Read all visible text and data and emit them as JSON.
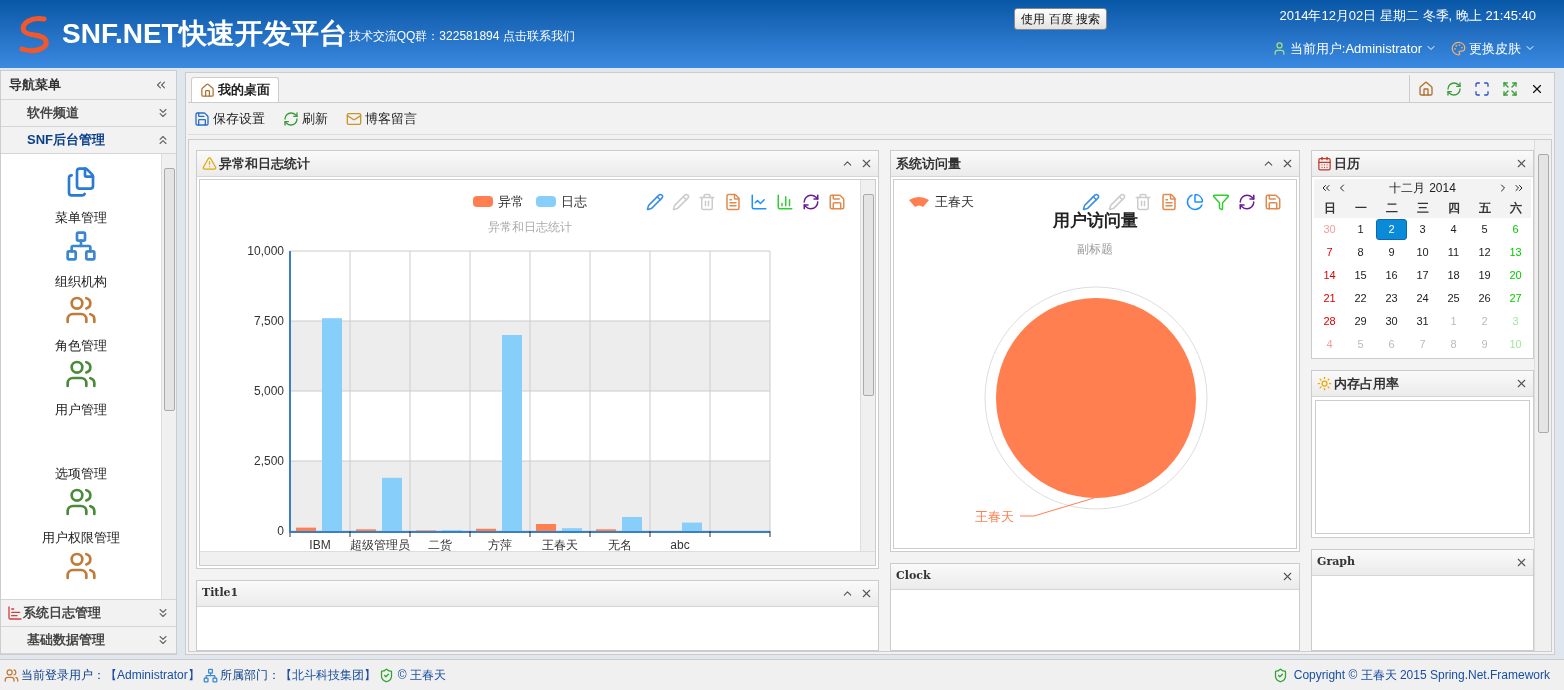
{
  "header": {
    "title": "SNF.NET快速开发平台",
    "qq_info": "技术交流QQ群：322581894 点击联系我们",
    "search_button": "使用 百度 搜索",
    "datetime": "2014年12月02日 星期二 冬季, 晚上 21:45:40",
    "current_user": "当前用户:Administrator",
    "skin_menu": "更换皮肤"
  },
  "sidebar": {
    "title": "导航菜单",
    "groups": [
      {
        "label": "软件频道",
        "kind": "plain",
        "expanded": false
      },
      {
        "label": "SNF后台管理",
        "kind": "plain",
        "expanded": true,
        "items": [
          {
            "label": "菜单管理",
            "kind": "menu"
          },
          {
            "label": "组织机构",
            "kind": "org"
          },
          {
            "label": "角色管理",
            "kind": "role"
          },
          {
            "label": "用户管理",
            "kind": "users"
          },
          {
            "label": "选项管理",
            "kind": "none"
          },
          {
            "label": "用户权限管理",
            "kind": "users"
          },
          {
            "kind": "role"
          }
        ]
      },
      {
        "label": "系统日志管理",
        "kind": "chart",
        "expanded": false
      },
      {
        "label": "基础数据管理",
        "kind": "plain",
        "expanded": false
      }
    ]
  },
  "tabs": [
    {
      "label": "我的桌面",
      "selected": true
    }
  ],
  "toolbar": [
    {
      "label": "保存设置",
      "kind": "save"
    },
    {
      "label": "刷新",
      "kind": "refresh"
    },
    {
      "label": "博客留言",
      "kind": "mail"
    }
  ],
  "portal": {
    "exceptions": {
      "title": "异常和日志统计",
      "collapsible": true,
      "chart_data": {
        "type": "bar",
        "title": "异常和日志统计",
        "categories": [
          "IBM",
          "超级管理员",
          "二货",
          "方萍",
          "王春天",
          "无名",
          "abc"
        ],
        "series": [
          {
            "name": "异常",
            "color": "#ff7f50",
            "values": [
              120,
              60,
              20,
              80,
              250,
              60,
              0
            ]
          },
          {
            "name": "日志",
            "color": "#87cefa",
            "values": [
              7600,
              1900,
              30,
              7000,
              100,
              500,
              300
            ]
          }
        ],
        "grid": true,
        "ylim": [
          0,
          10000
        ],
        "yticks": [
          {
            "value": 0,
            "label": "0"
          },
          {
            "value": 2500,
            "label": "2,500"
          },
          {
            "value": 5000,
            "label": "5,000"
          },
          {
            "value": 7500,
            "label": "7,500"
          },
          {
            "value": 10000,
            "label": "10,000"
          }
        ]
      }
    },
    "visits": {
      "title": "系统访问量",
      "collapsible": true,
      "legend": "王春天",
      "chart_title": "用户访问量",
      "chart_subtitle": "副标题",
      "slice_label": "王春天"
    },
    "calendar": {
      "title": "日历",
      "collapsible": false,
      "month": "十二月",
      "year": "2014",
      "weekdays": [
        "日",
        "一",
        "二",
        "三",
        "四",
        "五",
        "六"
      ],
      "weeks": [
        [
          {
            "day": "30",
            "outside": true,
            "selected": false
          },
          {
            "day": "1",
            "outside": false,
            "selected": false
          },
          {
            "day": "2",
            "outside": false,
            "selected": true
          },
          {
            "day": "3",
            "outside": false,
            "selected": false
          },
          {
            "day": "4",
            "outside": false,
            "selected": false
          },
          {
            "day": "5",
            "outside": false,
            "selected": false
          },
          {
            "day": "6",
            "outside": false,
            "selected": false
          }
        ],
        [
          {
            "day": "7",
            "outside": false,
            "selected": false
          },
          {
            "day": "8",
            "outside": false,
            "selected": false
          },
          {
            "day": "9",
            "outside": false,
            "selected": false
          },
          {
            "day": "10",
            "outside": false,
            "selected": false
          },
          {
            "day": "11",
            "outside": false,
            "selected": false
          },
          {
            "day": "12",
            "outside": false,
            "selected": false
          },
          {
            "day": "13",
            "outside": false,
            "selected": false
          }
        ],
        [
          {
            "day": "14",
            "outside": false,
            "selected": false
          },
          {
            "day": "15",
            "outside": false,
            "selected": false
          },
          {
            "day": "16",
            "outside": false,
            "selected": false
          },
          {
            "day": "17",
            "outside": false,
            "selected": false
          },
          {
            "day": "18",
            "outside": false,
            "selected": false
          },
          {
            "day": "19",
            "outside": false,
            "selected": false
          },
          {
            "day": "20",
            "outside": false,
            "selected": false
          }
        ],
        [
          {
            "day": "21",
            "outside": false,
            "selected": false
          },
          {
            "day": "22",
            "outside": false,
            "selected": false
          },
          {
            "day": "23",
            "outside": false,
            "selected": false
          },
          {
            "day": "24",
            "outside": false,
            "selected": false
          },
          {
            "day": "25",
            "outside": false,
            "selected": false
          },
          {
            "day": "26",
            "outside": false,
            "selected": false
          },
          {
            "day": "27",
            "outside": false,
            "selected": false
          }
        ],
        [
          {
            "day": "28",
            "outside": false,
            "selected": false
          },
          {
            "day": "29",
            "outside": false,
            "selected": false
          },
          {
            "day": "30",
            "outside": false,
            "selected": false
          },
          {
            "day": "31",
            "outside": false,
            "selected": false
          },
          {
            "day": "1",
            "outside": true,
            "selected": false
          },
          {
            "day": "2",
            "outside": true,
            "selected": false
          },
          {
            "day": "3",
            "outside": true,
            "selected": false
          }
        ],
        [
          {
            "day": "4",
            "outside": true,
            "selected": false
          },
          {
            "day": "5",
            "outside": true,
            "selected": false
          },
          {
            "day": "6",
            "outside": true,
            "selected": false
          },
          {
            "day": "7",
            "outside": true,
            "selected": false
          },
          {
            "day": "8",
            "outside": true,
            "selected": false
          },
          {
            "day": "9",
            "outside": true,
            "selected": false
          },
          {
            "day": "10",
            "outside": true,
            "selected": false
          }
        ]
      ]
    },
    "memory": {
      "title": "内存占用率",
      "collapsible": false
    },
    "title1": {
      "title": "Title1",
      "collapsible": true
    },
    "clock": {
      "title": "Clock",
      "collapsible": false
    },
    "graph": {
      "title": "Graph",
      "collapsible": false
    }
  },
  "footer": {
    "login_label": "当前登录用户：",
    "login_user": "【Administrator】",
    "dept_label": "所属部门：",
    "dept": "【北斗科技集团】",
    "author": "© 王春天",
    "copyright": "Copyright © 王春天 2015 Spring.Net.Framework"
  }
}
